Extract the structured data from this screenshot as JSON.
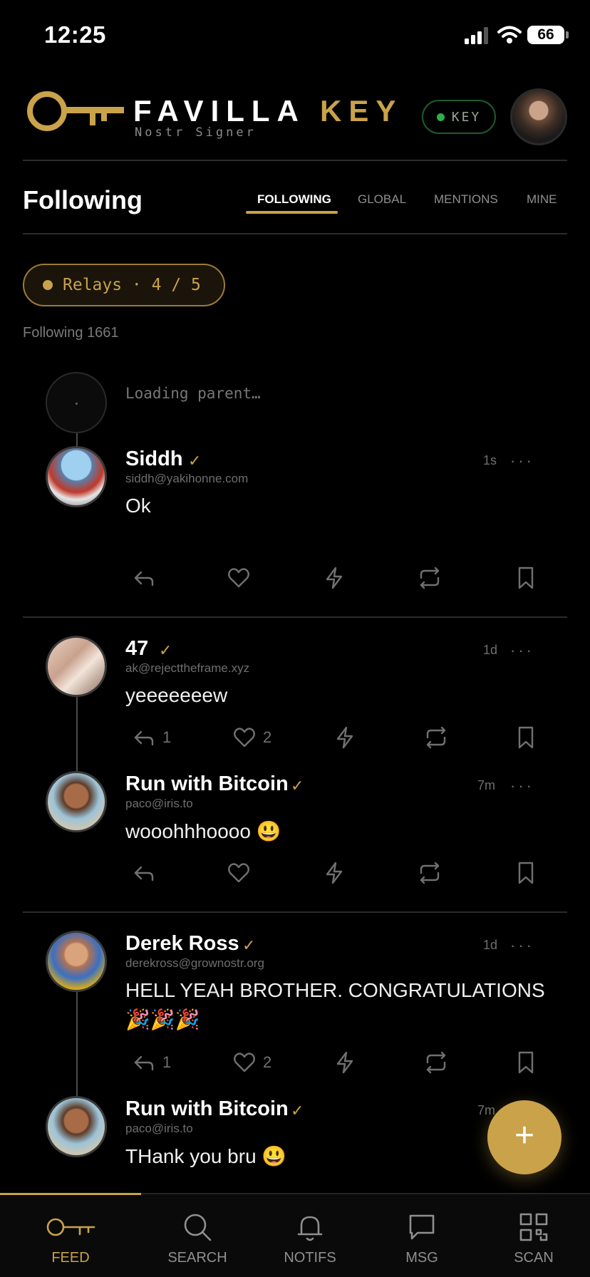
{
  "status_bar": {
    "time": "12:25",
    "battery": "66"
  },
  "header": {
    "brand_word1": "FAVILLA",
    "brand_word2": "KEY",
    "brand_subtitle": "Nostr Signer",
    "key_badge": "KEY"
  },
  "feed_header": {
    "title": "Following",
    "tabs": [
      {
        "label": "FOLLOWING",
        "active": true
      },
      {
        "label": "GLOBAL",
        "active": false
      },
      {
        "label": "MENTIONS",
        "active": false
      },
      {
        "label": "MINE",
        "active": false
      }
    ]
  },
  "relays": {
    "label": "Relays · 4 / 5"
  },
  "following_count": "Following 1661",
  "loading_parent": "Loading parent…",
  "posts": [
    {
      "name": "Siddh",
      "handle": "siddh@yakihonne.com",
      "time": "1s",
      "text": "Ok",
      "replies": "",
      "likes": ""
    },
    {
      "name": "47",
      "handle": "ak@rejecttheframe.xyz",
      "time": "1d",
      "text": "yeeeeeeew",
      "replies": "1",
      "likes": "2"
    },
    {
      "name": "Run with Bitcoin",
      "handle": "paco@iris.to",
      "time": "7m",
      "text": "wooohhhoooo 😃",
      "replies": "",
      "likes": ""
    },
    {
      "name": "Derek Ross",
      "handle": "derekross@grownostr.org",
      "time": "1d",
      "text_line1": "HELL YEAH BROTHER. CONGRATULATIONS",
      "text_line2": "🎉🎉🎉",
      "replies": "1",
      "likes": "2"
    },
    {
      "name": "Run with Bitcoin",
      "handle": "paco@iris.to",
      "time": "7m",
      "text": "THank you bru 😃"
    }
  ],
  "verified_mark": "✓",
  "more_mark": "···",
  "fab_label": "+",
  "nav": [
    {
      "label": "FEED",
      "icon": "key-icon",
      "active": true
    },
    {
      "label": "SEARCH",
      "icon": "search-icon",
      "active": false
    },
    {
      "label": "NOTIFS",
      "icon": "bell-icon",
      "active": false
    },
    {
      "label": "MSG",
      "icon": "message-icon",
      "active": false
    },
    {
      "label": "SCAN",
      "icon": "qr-icon",
      "active": false
    }
  ],
  "colors": {
    "accent": "#c9a24a",
    "background": "#000000",
    "online": "#2fae4e"
  }
}
